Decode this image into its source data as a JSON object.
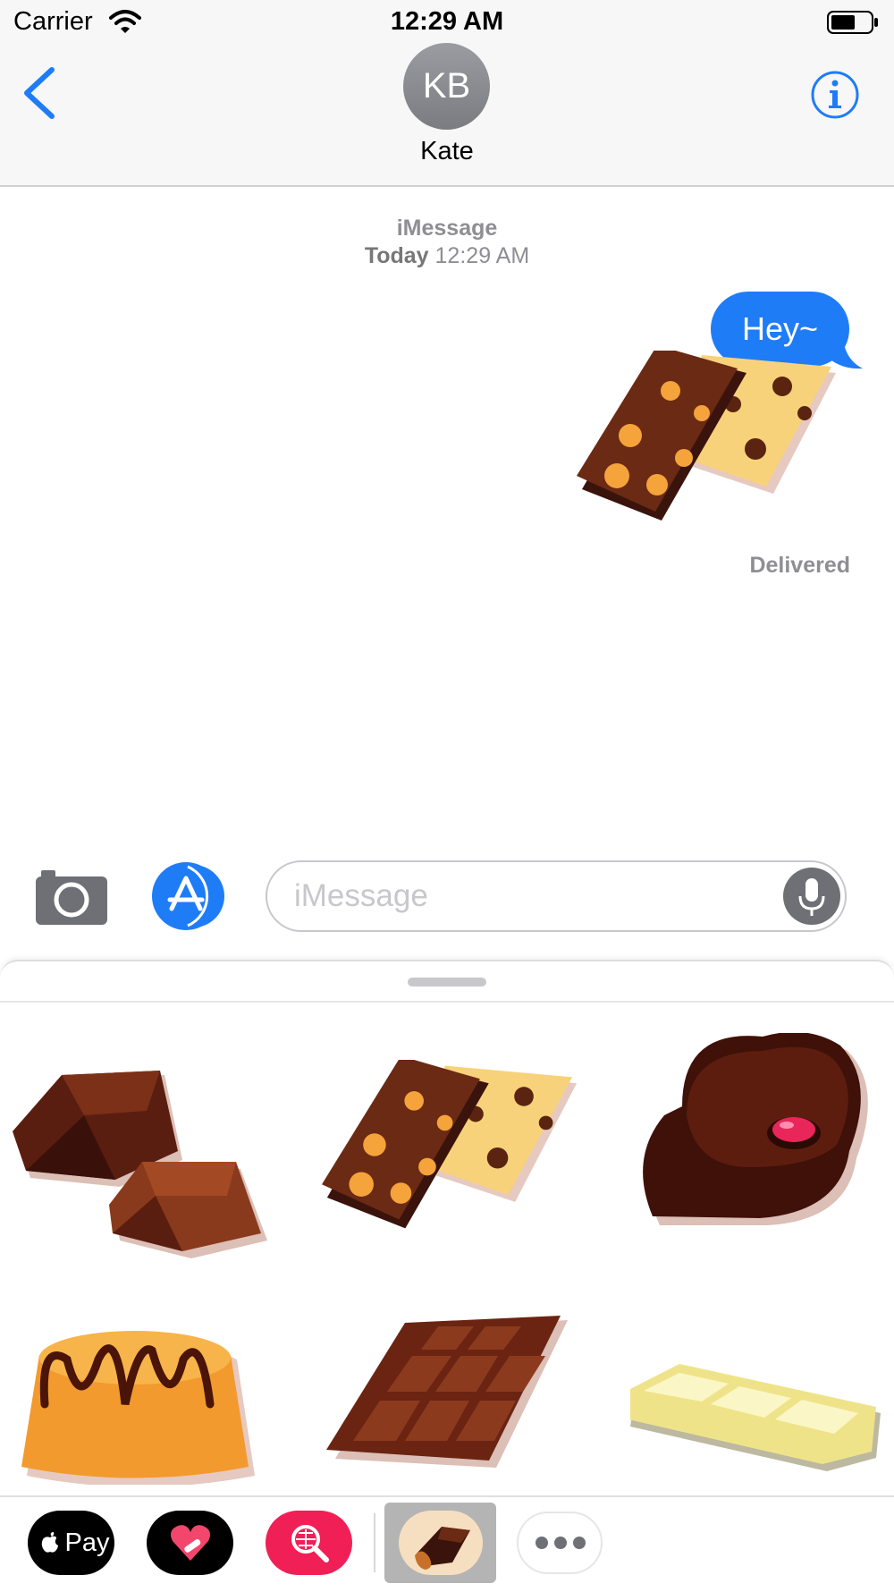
{
  "status_bar": {
    "carrier": "Carrier",
    "time": "12:29 AM",
    "wifi_icon": "wifi-icon",
    "battery_icon": "battery-icon"
  },
  "header": {
    "back_icon": "chevron-left-icon",
    "avatar_initials": "KB",
    "contact_name": "Kate",
    "info_icon": "info-icon",
    "accent_color": "#1f7cf7"
  },
  "conversation": {
    "service": "iMessage",
    "day": "Today",
    "time": "12:29 AM",
    "messages": [
      {
        "type": "text",
        "text": "Hey~",
        "sender": "me"
      },
      {
        "type": "sticker",
        "sticker": "nut-chocolate-bars-sticker",
        "sender": "me"
      }
    ],
    "status": "Delivered"
  },
  "compose": {
    "camera_icon": "camera-icon",
    "appstore_icon": "appstore-icon",
    "placeholder": "iMessage",
    "mic_icon": "microphone-icon"
  },
  "sticker_drawer": {
    "stickers": [
      "chocolate-chunks-sticker",
      "nut-chocolate-bars-sticker",
      "heart-chocolate-sticker",
      "caramel-cake-sticker",
      "chocolate-bar-sticker",
      "white-chocolate-bar-sticker"
    ]
  },
  "app_strip": {
    "apple_pay_label": "Pay",
    "apps": [
      "apple-pay-icon",
      "digital-touch-icon",
      "web-search-icon",
      "chocolate-stickers-app-icon",
      "more-icon"
    ],
    "selected": "chocolate-stickers-app-icon"
  }
}
